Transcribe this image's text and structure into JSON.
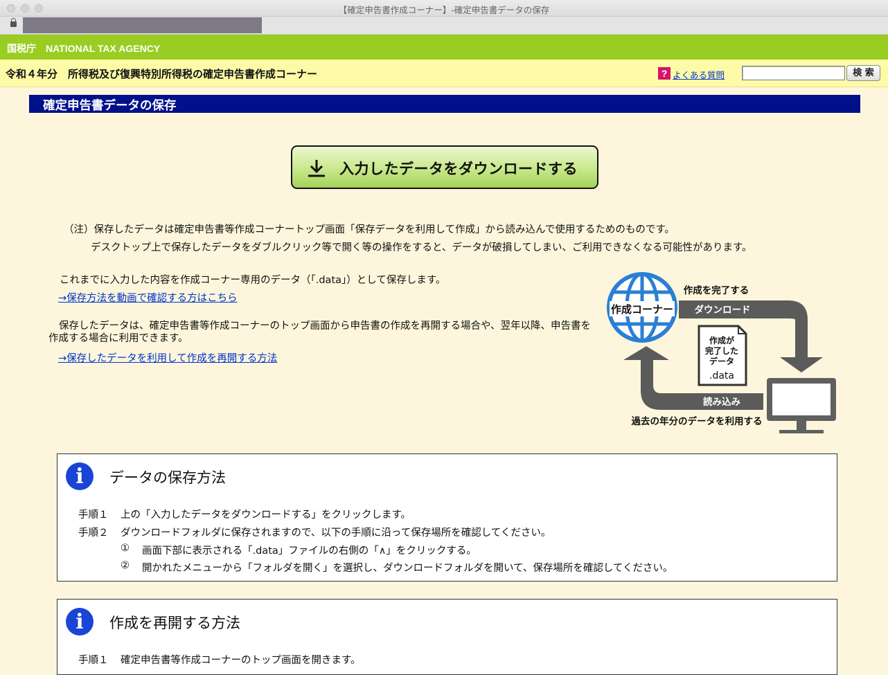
{
  "window": {
    "title": "【確定申告書作成コーナー】-確定申告書データの保存"
  },
  "header": {
    "agency": "国税庁　NATIONAL TAX AGENCY",
    "corner_title": "令和４年分　所得税及び復興特別所得税の確定申告書作成コーナー",
    "faq_icon": "?",
    "faq_label": "よくある質問",
    "search_value": "",
    "search_button": "検 索"
  },
  "page": {
    "title": "確定申告書データの保存",
    "download_button": "入力したデータをダウンロードする",
    "note_line1": "（注）保存したデータは確定申告書等作成コーナートップ画面「保存データを利用して作成」から読み込んで使用するためのものです。",
    "note_line2": "デスクトップ上で保存したデータをダブルクリック等で開く等の操作をすると、データが破損してしまい、ご利用できなくなる可能性があります。",
    "para1": "これまでに入力した内容を作成コーナー専用のデータ（「.data」）として保存します。",
    "link1": "→保存方法を動画で確認する方はこちら",
    "para2": "保存したデータは、確定申告書等作成コーナーのトップ画面から申告書の作成を再開する場合や、翌年以降、申告書を作成する場合に利用できます。",
    "link2": "→保存したデータを利用して作成を再開する方法"
  },
  "diagram": {
    "globe_label": "作成コーナー",
    "complete_label": "作成を完了する",
    "download_label": "ダウンロード",
    "file_line1": "作成が",
    "file_line2": "完了した",
    "file_line3": "データ",
    "file_ext": ".data",
    "load_label": "読み込み",
    "past_label": "過去の年分のデータを利用する"
  },
  "save_box": {
    "icon": "i",
    "title": "データの保存方法",
    "step1_label": "手順１",
    "step1_text": "上の「入力したデータをダウンロードする」をクリックします。",
    "step2_label": "手順２",
    "step2_text": "ダウンロードフォルダに保存されますので、以下の手順に沿って保存場所を確認してください。",
    "sub1_mark": "①",
    "sub1_text": "画面下部に表示される「.data」ファイルの右側の「∧」をクリックする。",
    "sub2_mark": "②",
    "sub2_text": "開かれたメニューから「フォルダを開く」を選択し、ダウンロードフォルダを開いて、保存場所を確認してください。"
  },
  "resume_box": {
    "icon": "i",
    "title": "作成を再開する方法",
    "step1_label": "手順１",
    "step1_text": "確定申告書等作成コーナーのトップ画面を開きます。"
  },
  "colors": {
    "header_green": "#9acd22",
    "header_yellow": "#fdfba8",
    "title_navy": "#00108a",
    "page_bg": "#fdf6dc",
    "info_blue": "#1a44d6",
    "link_blue": "#0033cc"
  }
}
